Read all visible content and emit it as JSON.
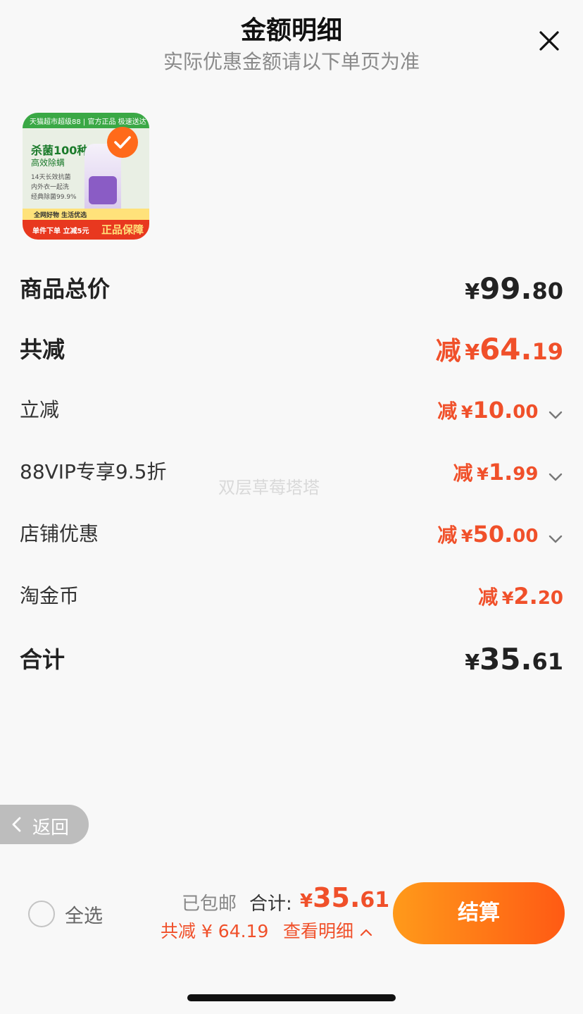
{
  "header": {
    "title": "金额明细",
    "subtitle": "实际优惠金额请以下单页为准"
  },
  "product": {
    "top_band": "天猫超市超级88 | 官方正品 极速送达",
    "headline": "杀菌100种",
    "subhead": "高效除螨",
    "features": [
      "14天长效抗菌",
      "内外衣一起洗",
      "经典除菌99.9%"
    ],
    "banner_line1": "全网好物 生活优选",
    "banner_line2": "单件下单 立减5元",
    "banner_badge": "正品保障",
    "selected": true
  },
  "summary": {
    "subtotal": {
      "label": "商品总价",
      "yen": "¥",
      "int": "99.",
      "dec": "80"
    },
    "total_discount": {
      "label": "共减",
      "prefix": "减",
      "yen": "¥",
      "int": "64.",
      "dec": "19"
    },
    "discounts": [
      {
        "label": "立减",
        "prefix": "减",
        "yen": "¥",
        "int": "10.",
        "dec": "00",
        "expandable": true
      },
      {
        "label": "88VIP专享9.5折",
        "prefix": "减",
        "yen": "¥",
        "int": "1.",
        "dec": "99",
        "expandable": true
      },
      {
        "label": "店铺优惠",
        "prefix": "减",
        "yen": "¥",
        "int": "50.",
        "dec": "00",
        "expandable": true
      },
      {
        "label": "淘金币",
        "prefix": "减",
        "yen": "¥",
        "int": "2.",
        "dec": "20",
        "expandable": false
      }
    ],
    "total": {
      "label": "合计",
      "yen": "¥",
      "int": "35.",
      "dec": "61"
    }
  },
  "watermark": "双层草莓塔塔",
  "back_button": {
    "label": "返回"
  },
  "footer": {
    "select_all": "全选",
    "shipping": "已包邮",
    "total_label": "合计:",
    "total_yen": "¥",
    "total_int": "35.",
    "total_dec": "61",
    "savings": "共减 ¥ 64.19",
    "detail_link": "查看明细",
    "checkout": "结算"
  },
  "colors": {
    "accent": "#f0502a",
    "checkout_start": "#ff9a1a",
    "checkout_end": "#ff5a14",
    "background": "#f8f8f8"
  },
  "icons": {
    "close": "close-icon",
    "check": "checkmark-icon",
    "chevron": "chevron-down-icon",
    "back": "chevron-left-icon",
    "detail": "chevron-up-icon"
  }
}
